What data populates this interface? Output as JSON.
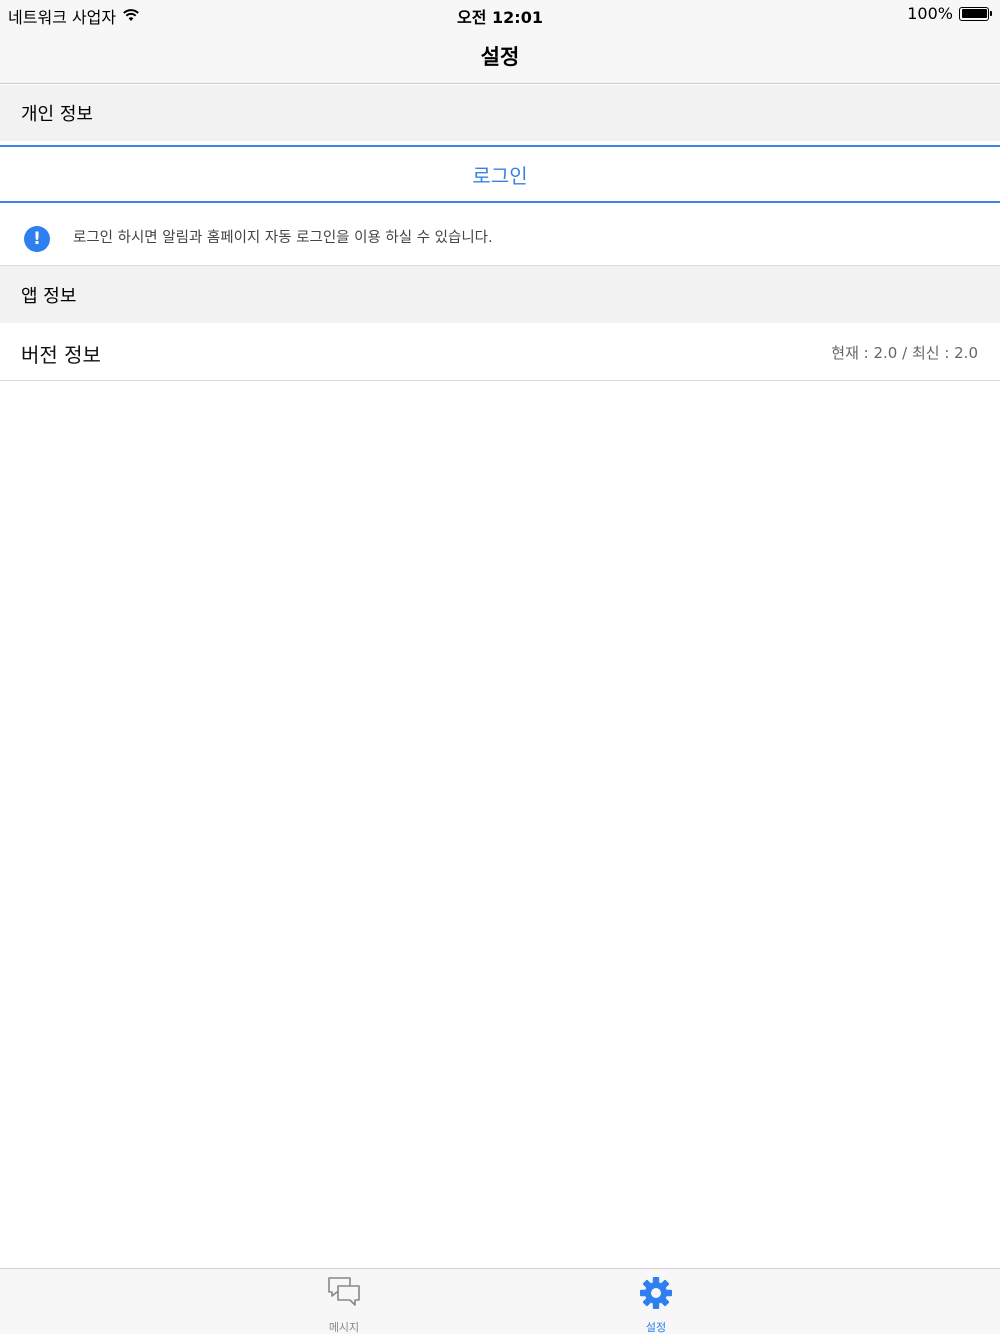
{
  "status_bar": {
    "carrier": "네트워크 사업자",
    "time": "오전 12:01",
    "battery": "100%"
  },
  "nav": {
    "title": "설정"
  },
  "sections": {
    "personal": "개인 정보",
    "app": "앱 정보"
  },
  "login": {
    "label": "로그인"
  },
  "info": {
    "icon_glyph": "!",
    "text": "로그인 하시면 알림과 홈페이지 자동 로그인을 이용 하실 수 있습니다."
  },
  "version": {
    "label": "버전 정보",
    "current_label": "현재",
    "current": "2.0",
    "latest_label": "최신",
    "latest": "2.0"
  },
  "tabs": {
    "messages": "메시지",
    "settings": "설정",
    "active": "settings"
  },
  "colors": {
    "accent": "#3b82e4",
    "info_icon": "#2f7ff0",
    "section_bg": "#f2f2f2"
  }
}
